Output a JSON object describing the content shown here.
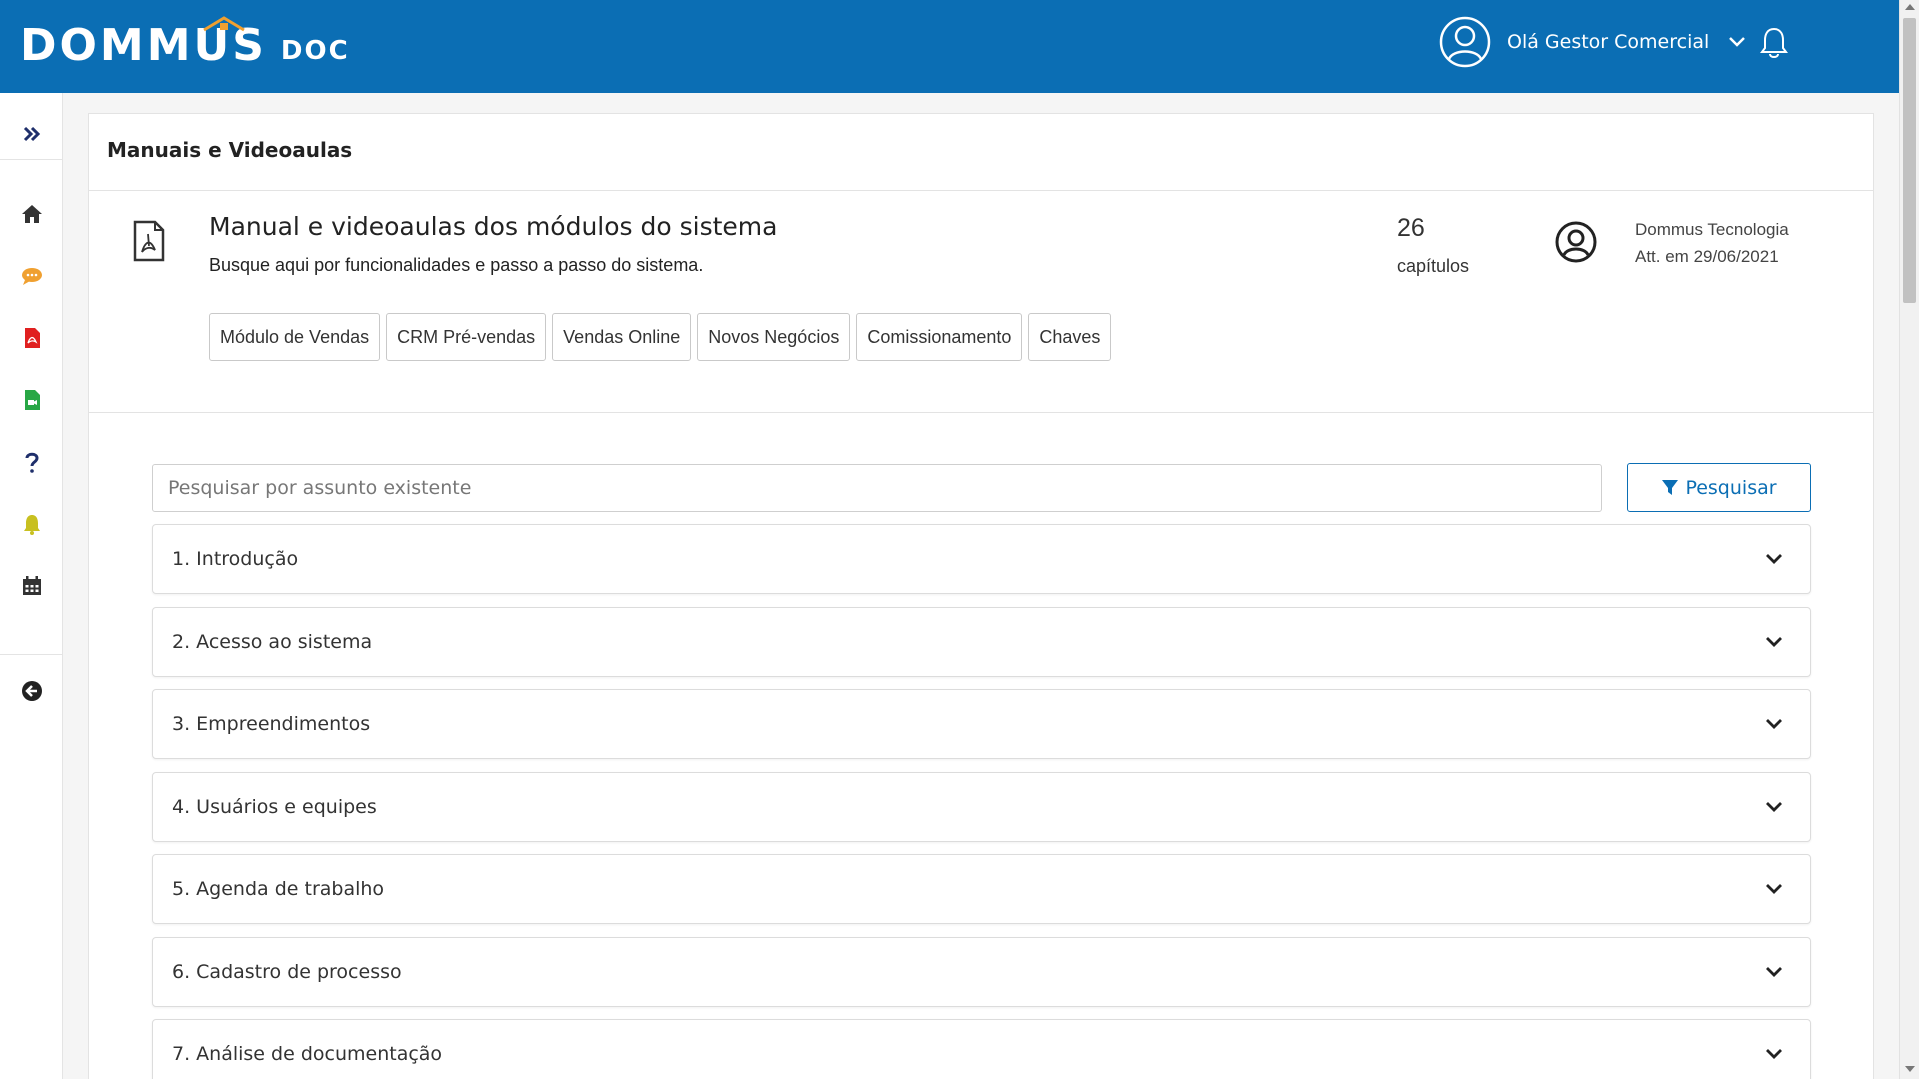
{
  "brand": {
    "name": "DOMMUS",
    "suffix": "DOC",
    "accent_color": "#0b6eb4",
    "roof_color": "#f0a030"
  },
  "header": {
    "greeting": "Olá Gestor Comercial",
    "avatar_icon": "user-circle-icon",
    "menu_icon": "chevron-down-icon",
    "notifications_icon": "bell-icon"
  },
  "sidebar": {
    "items": [
      {
        "icon": "double-chevron-right-icon",
        "color": "#1f2f6b"
      },
      {
        "icon": "home-icon",
        "color": "#333333"
      },
      {
        "icon": "chat-bubble-icon",
        "color": "#f0a030"
      },
      {
        "icon": "pdf-file-icon",
        "color": "#e02020"
      },
      {
        "icon": "video-file-icon",
        "color": "#28a745"
      },
      {
        "icon": "question-icon",
        "color": "#1f2f6b"
      },
      {
        "icon": "bell-icon",
        "color": "#c8c020"
      },
      {
        "icon": "calendar-icon",
        "color": "#333333"
      },
      {
        "icon": "back-arrow-icon",
        "color": "#333333"
      }
    ]
  },
  "page": {
    "title": "Manuais e Videoaulas"
  },
  "document": {
    "icon": "pdf-outline-icon",
    "title": "Manual e videoaulas dos módulos do sistema",
    "subtitle": "Busque aqui por funcionalidades e passo a passo do sistema.",
    "chapter_count": "26",
    "chapter_label": "capítulos",
    "author_icon": "user-circle-icon",
    "author": "Dommus Tecnologia",
    "updated": "Att. em 29/06/2021"
  },
  "tags": [
    "Módulo de Vendas",
    "CRM Pré-vendas",
    "Vendas Online",
    "Novos Negócios",
    "Comissionamento",
    "Chaves"
  ],
  "search": {
    "placeholder": "Pesquisar por assunto existente",
    "value": "",
    "button_label": "Pesquisar",
    "button_icon": "filter-icon"
  },
  "chapters": [
    "1. Introdução",
    "2. Acesso ao sistema",
    "3. Empreendimentos",
    "4. Usuários e equipes",
    "5. Agenda de trabalho",
    "6. Cadastro de processo",
    "7. Análise de documentação"
  ]
}
